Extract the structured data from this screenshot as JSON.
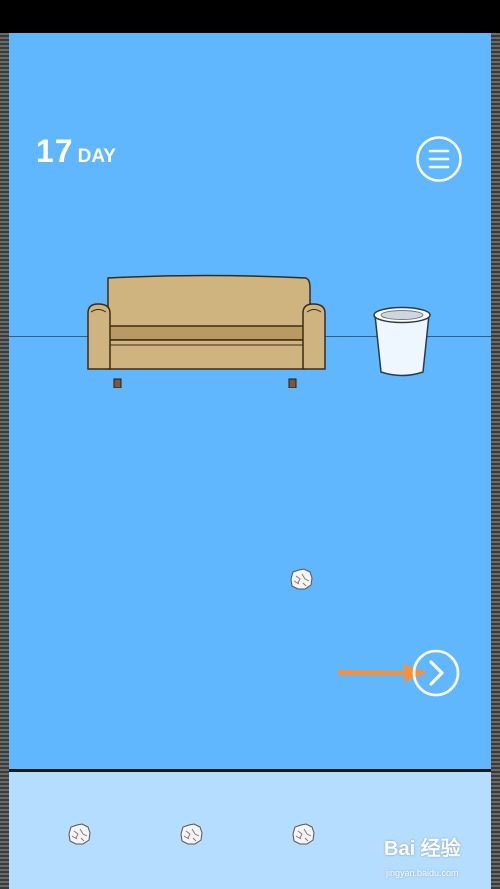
{
  "hud": {
    "day_number": "17",
    "day_label": "DAY"
  },
  "icons": {
    "menu": "hamburger-menu-icon",
    "next": "chevron-right-circle-icon",
    "pointer": "orange-arrow-icon",
    "item": "crumpled-paper-ball-icon"
  },
  "scene": {
    "objects": [
      "sofa",
      "trash-can",
      "crumpled-paper-ball"
    ]
  },
  "inventory": {
    "items": [
      "crumpled-paper-ball",
      "crumpled-paper-ball",
      "crumpled-paper-ball"
    ]
  },
  "watermark": {
    "logo": "Bai 经验",
    "url": "jingyan.baidu.com"
  },
  "colors": {
    "sky": "#61b7fe",
    "inventory_bg": "#b5ddff",
    "sofa": "#d0b47f",
    "arrow": "#f4913e"
  }
}
